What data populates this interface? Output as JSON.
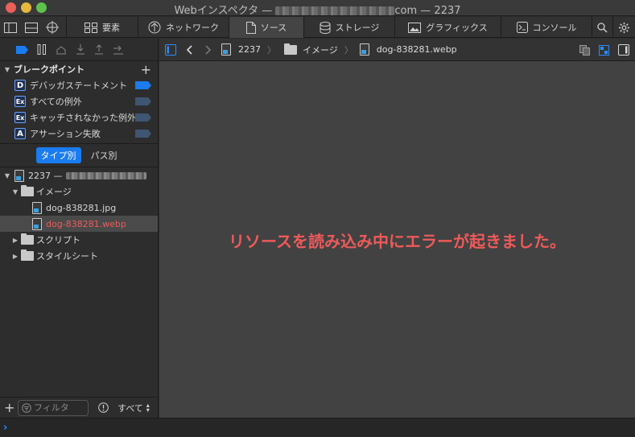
{
  "window": {
    "title_prefix": "Webインスペクタ — ",
    "title_suffix": "com — 2237"
  },
  "tabs": [
    {
      "label": "要素",
      "icon": "elements-icon"
    },
    {
      "label": "ネットワーク",
      "icon": "network-icon"
    },
    {
      "label": "ソース",
      "icon": "sources-icon",
      "active": true
    },
    {
      "label": "ストレージ",
      "icon": "storage-icon"
    },
    {
      "label": "グラフィックス",
      "icon": "graphics-icon"
    },
    {
      "label": "コンソール",
      "icon": "console-icon"
    }
  ],
  "breakpoints": {
    "header": "ブレークポイント",
    "items": [
      {
        "badge": "D",
        "label": "デバッガステートメント",
        "enabled": true
      },
      {
        "badge": "Ex",
        "label": "すべての例外",
        "enabled": false
      },
      {
        "badge": "Ex",
        "label": "キャッチされなかった例外",
        "enabled": false
      },
      {
        "badge": "A",
        "label": "アサーション失敗",
        "enabled": false
      }
    ]
  },
  "scope": {
    "by_type": "タイプ別",
    "by_path": "パス別"
  },
  "tree": {
    "root": "2237 — ",
    "images_folder": "イメージ",
    "file_jpg": "dog-838281.jpg",
    "file_webp": "dog-838281.webp",
    "scripts_folder": "スクリプト",
    "stylesheets_folder": "スタイルシート"
  },
  "filter": {
    "placeholder": "フィルタ",
    "scope_label": "すべて"
  },
  "breadcrumb": {
    "root": "2237",
    "folder": "イメージ",
    "file": "dog-838281.webp"
  },
  "error_message": "リソースを読み込み中にエラーが起きました。",
  "colors": {
    "accent": "#1a7cf0",
    "error": "#ef5a5a"
  }
}
